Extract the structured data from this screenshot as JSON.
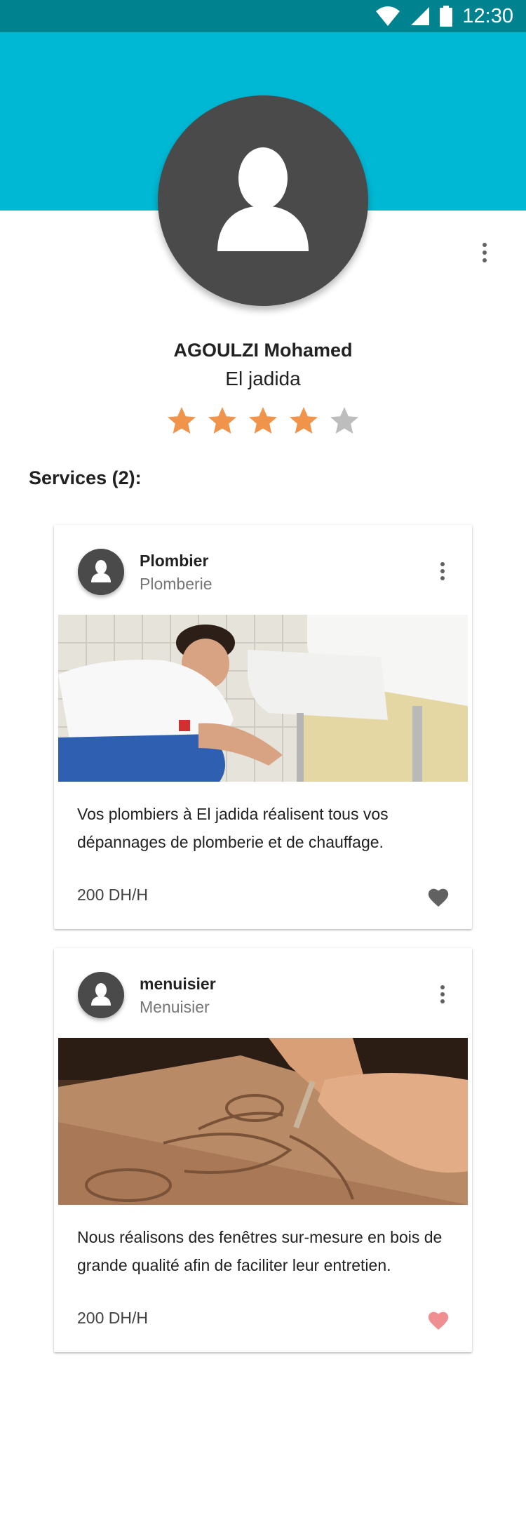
{
  "status_bar": {
    "time": "12:30",
    "icons": [
      "wifi-icon",
      "signal-icon",
      "battery-icon"
    ]
  },
  "profile": {
    "name": "AGOULZI Mohamed",
    "city": "El jadida",
    "rating": 4,
    "rating_max": 5,
    "header_color": "#00b8d4",
    "star_filled_color": "#f0944b",
    "star_empty_color": "#bdbdbd"
  },
  "services": {
    "title": "Services (2):",
    "items": [
      {
        "title": "Plombier",
        "category": "Plomberie",
        "image": "plumber-photo",
        "description": "Vos plombiers à El jadida réalisent tous vos dépannages de plomberie et de chauffage.",
        "price": "200 DH/H",
        "favorite": false,
        "heart_color": "#616161"
      },
      {
        "title": "menuisier",
        "category": "Menuisier",
        "image": "wood-carving-photo",
        "description": "Nous réalisons des fenêtres sur-mesure en bois de grande qualité afin de faciliter leur entretien.",
        "price": "200 DH/H",
        "favorite": true,
        "heart_color": "#ef8f92"
      }
    ]
  }
}
